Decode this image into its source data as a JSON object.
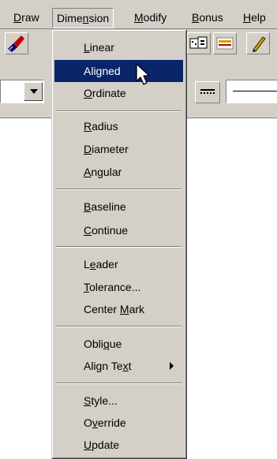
{
  "menubar": {
    "items": [
      {
        "label": "Draw",
        "mnemonic": "D",
        "pre": "",
        "post": "raw"
      },
      {
        "label": "Dimension",
        "pre": "Dime",
        "mnemonic": "n",
        "post": "sion"
      },
      {
        "label": "Modify",
        "pre": "",
        "mnemonic": "M",
        "post": "odify"
      },
      {
        "label": "Bonus",
        "pre": "",
        "mnemonic": "B",
        "post": "onus"
      },
      {
        "label": "Help",
        "pre": "",
        "mnemonic": "H",
        "post": "elp"
      }
    ]
  },
  "toolbars": {
    "icons": [
      "paintbrush-icon",
      "layer-lock-icon",
      "lineweight-icon",
      "pencil-icon",
      "linetype-icon"
    ]
  },
  "dimension_menu": {
    "items": [
      {
        "label": "Linear",
        "pre": "",
        "mnemonic": "L",
        "post": "inear"
      },
      {
        "label": "Aligned",
        "pre": "",
        "mnemonic": "",
        "post": "Aligned",
        "selected": true
      },
      {
        "label": "Ordinate",
        "pre": "",
        "mnemonic": "O",
        "post": "rdinate"
      },
      {
        "label": "Radius",
        "pre": "",
        "mnemonic": "R",
        "post": "adius"
      },
      {
        "label": "Diameter",
        "pre": "",
        "mnemonic": "D",
        "post": "iameter"
      },
      {
        "label": "Angular",
        "pre": "",
        "mnemonic": "A",
        "post": "ngular"
      },
      {
        "label": "Baseline",
        "pre": "",
        "mnemonic": "B",
        "post": "aseline"
      },
      {
        "label": "Continue",
        "pre": "",
        "mnemonic": "C",
        "post": "ontinue"
      },
      {
        "label": "Leader",
        "pre": "L",
        "mnemonic": "e",
        "post": "ader"
      },
      {
        "label": "Tolerance...",
        "pre": "",
        "mnemonic": "T",
        "post": "olerance..."
      },
      {
        "label": "Center Mark",
        "pre": "Center ",
        "mnemonic": "M",
        "post": "ark"
      },
      {
        "label": "Oblique",
        "pre": "Obli",
        "mnemonic": "q",
        "post": "ue"
      },
      {
        "label": "Align Text",
        "pre": "Align Te",
        "mnemonic": "x",
        "post": "t",
        "submenu": true
      },
      {
        "label": "Style...",
        "pre": "",
        "mnemonic": "S",
        "post": "tyle..."
      },
      {
        "label": "Override",
        "pre": "O",
        "mnemonic": "v",
        "post": "erride"
      },
      {
        "label": "Update",
        "pre": "",
        "mnemonic": "U",
        "post": "pdate"
      }
    ]
  }
}
